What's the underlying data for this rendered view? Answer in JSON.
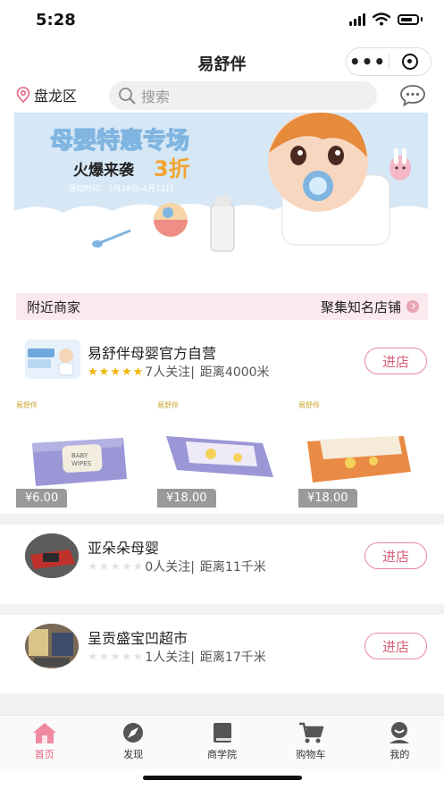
{
  "status_bar": {
    "time": "5:28"
  },
  "nav": {
    "title": "易舒伴"
  },
  "location": {
    "city": "盘龙区"
  },
  "search": {
    "placeholder": "搜索"
  },
  "banner": {
    "headline": "母婴特惠专场",
    "subline_prefix": "火爆来袭",
    "subline_highlight": "3折",
    "dates": "活动时间：3月26日-4月12日"
  },
  "nearby": {
    "title": "附近商家",
    "link_label": "聚集知名店铺"
  },
  "stores": [
    {
      "name": "易舒伴母婴官方自营",
      "stars": 5,
      "followers": "7人关注|",
      "distance": "距离4000米",
      "enter_label": "进店",
      "products": [
        {
          "price": "¥6.00",
          "brand": "易舒伴",
          "color": "#8b87c9"
        },
        {
          "price": "¥18.00",
          "brand": "易舒伴",
          "color": "#8b87c9"
        },
        {
          "price": "¥18.00",
          "brand": "易舒伴",
          "color": "#e0803a"
        }
      ]
    },
    {
      "name": "亚朵朵母婴",
      "stars": 0,
      "followers": "0人关注|",
      "distance": "距离11千米",
      "enter_label": "进店"
    },
    {
      "name": "呈贡盛宝凹超市",
      "stars": 0,
      "followers": "1人关注|",
      "distance": "距离17千米",
      "enter_label": "进店"
    }
  ],
  "tabs": [
    {
      "label": "首页",
      "icon": "home-icon",
      "active": true
    },
    {
      "label": "发现",
      "icon": "discover-icon",
      "active": false
    },
    {
      "label": "商学院",
      "icon": "book-icon",
      "active": false
    },
    {
      "label": "购物车",
      "icon": "cart-icon",
      "active": false
    },
    {
      "label": "我的",
      "icon": "user-icon",
      "active": false
    }
  ],
  "colors": {
    "accent": "#e8637f",
    "banner_bg": "#cfe3f4"
  }
}
